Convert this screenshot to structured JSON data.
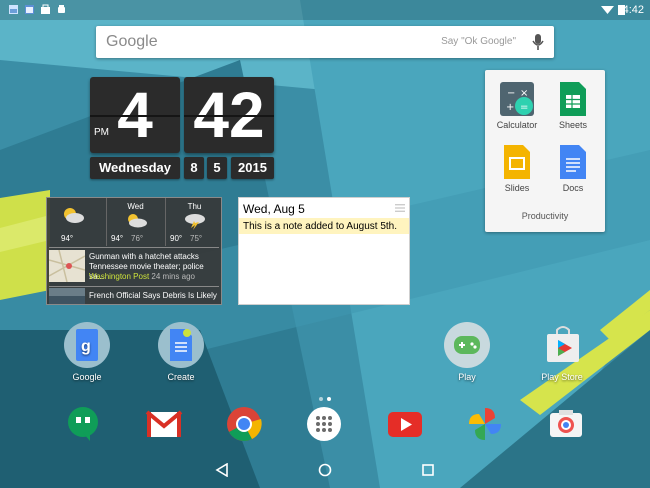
{
  "statusbar": {
    "time": "4:42",
    "notif_icons": [
      "gallery-icon",
      "calendar-icon",
      "shopping-bag-icon",
      "android-icon"
    ],
    "right_icons": [
      "wifi-icon",
      "battery-icon"
    ]
  },
  "search": {
    "logo": "Google",
    "hint": "Say \"Ok Google\""
  },
  "clock": {
    "hour": "4",
    "minute": "42",
    "ampm": "PM",
    "weekday": "Wednesday",
    "month": "8",
    "day": "5",
    "year": "2015"
  },
  "weather": [
    {
      "day": "",
      "temp_hi": "94°",
      "temp_lo": "",
      "icon": "partly-cloudy-icon"
    },
    {
      "day": "Wed",
      "temp_hi": "94°",
      "temp_lo": "76°",
      "icon": "partly-cloudy-icon"
    },
    {
      "day": "Thu",
      "temp_hi": "90°",
      "temp_lo": "75°",
      "icon": "thunderstorm-icon"
    }
  ],
  "news": [
    {
      "headline": "Gunman with a hatchet attacks Tennessee movie theater; police sa...",
      "source": "Washington Post",
      "ago": "24 mins ago"
    },
    {
      "headline": "French Official Says Debris Is Likely",
      "source": "",
      "ago": ""
    }
  ],
  "note": {
    "date": "Wed, Aug 5",
    "text": "This is a note added to August 5th."
  },
  "folder": {
    "label": "Productivity",
    "apps": [
      "Calculator",
      "Sheets",
      "Slides",
      "Docs"
    ]
  },
  "home_icons": [
    "Google",
    "Create",
    "Play",
    "Play Store"
  ],
  "dock": [
    "Hangouts",
    "Gmail",
    "Chrome",
    "Apps",
    "YouTube",
    "Photos",
    "Camera"
  ],
  "colors": {
    "accent_lime": "#cde23b",
    "wall_teal": "#3a8fa8",
    "note_yellow": "#fff4bf"
  }
}
